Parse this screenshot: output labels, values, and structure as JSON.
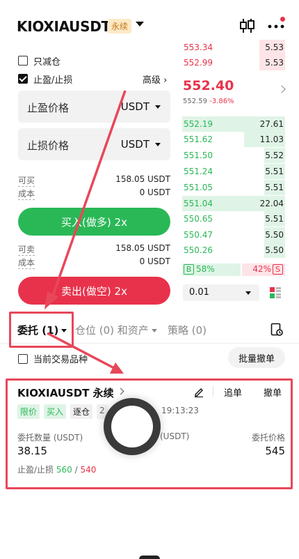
{
  "header": {
    "symbol": "KIOXIAUSDT",
    "contract_badge": "永续",
    "colors": {
      "badge_bg": "#fbe9c7",
      "badge_text": "#c77a12"
    }
  },
  "form": {
    "reduce_only_label": "只减仓",
    "tpsl_label": "止盈/止损",
    "advanced_label": "高级 ›",
    "tp_price_label": "止盈价格",
    "sl_price_label": "止损价格",
    "unit": "USDT",
    "buy_available_label": "可买",
    "buy_available_value": "158.05 USDT",
    "buy_cost_label": "成本",
    "buy_cost_value": "0 USDT",
    "buy_button": "买入(做多) 2x",
    "sell_available_label": "可卖",
    "sell_available_value": "158.05 USDT",
    "sell_cost_label": "成本",
    "sell_cost_value": "0 USDT",
    "sell_button": "卖出(做空) 2x"
  },
  "orderbook": {
    "asks": [
      {
        "price": "553.34",
        "qty": "5.53"
      },
      {
        "price": "552.99",
        "qty": "5.53"
      }
    ],
    "last_price": "552.40",
    "mark_price": "552.59",
    "change_pct": "-3.86%",
    "bids": [
      {
        "price": "552.19",
        "qty": "27.61"
      },
      {
        "price": "551.62",
        "qty": "11.03"
      },
      {
        "price": "551.50",
        "qty": "5.52"
      },
      {
        "price": "551.24",
        "qty": "5.51"
      },
      {
        "price": "551.05",
        "qty": "5.51"
      },
      {
        "price": "551.04",
        "qty": "22.04"
      },
      {
        "price": "550.65",
        "qty": "5.51"
      },
      {
        "price": "550.47",
        "qty": "5.50"
      },
      {
        "price": "550.26",
        "qty": "5.50"
      }
    ],
    "buy_ratio_tag": "B",
    "buy_ratio": "58%",
    "sell_ratio": "42%",
    "sell_ratio_tag": "S",
    "precision": "0.01",
    "colors": {
      "ask": "#e8324b",
      "bid": "#2ab857"
    }
  },
  "tabs": {
    "orders": "委托 (1)",
    "positions": "仓位 (0) 和资产",
    "strategy": "策略 (0)"
  },
  "filter": {
    "current_symbol_label": "当前交易品种",
    "cancel_all_button": "批量撤单"
  },
  "order_card": {
    "symbol": "KIOXIAUSDT 永续",
    "chase_button": "追单",
    "cancel_button": "撤单",
    "tags": [
      "限价",
      "买入",
      "逐仓"
    ],
    "time_prefix": "2",
    "time_suffix": "19:13:23",
    "qty_label": "委托数量 (USDT)",
    "mid_label_suffix": "(USDT)",
    "price_label": "委托价格",
    "qty_value": "38.15",
    "price_value": "545",
    "tpsl_label": "止盈/止损",
    "tp_value": "560",
    "tpsl_sep": " / ",
    "sl_value": "540"
  }
}
